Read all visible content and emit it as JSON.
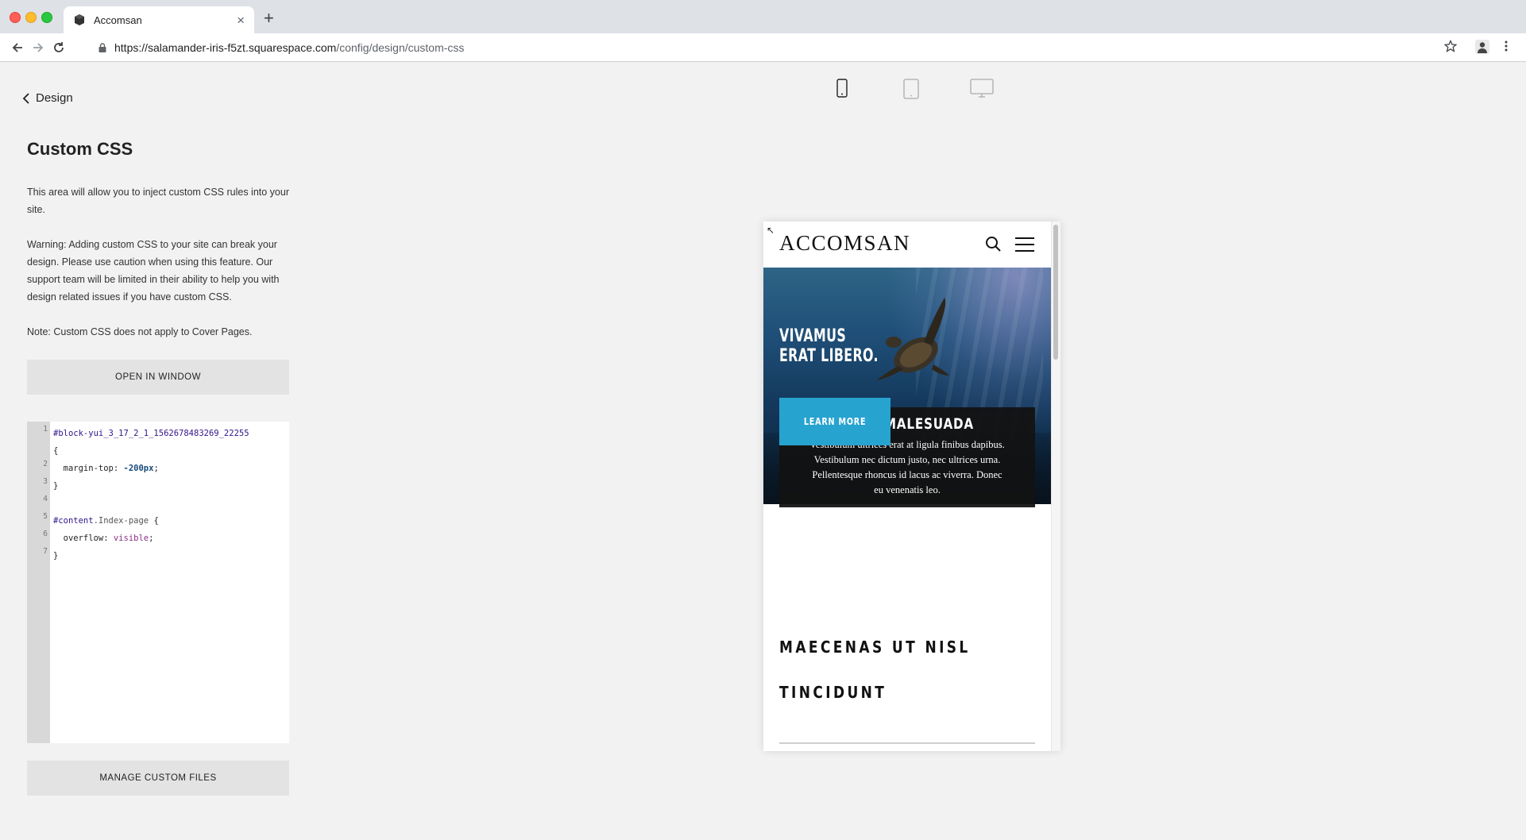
{
  "browser": {
    "tab_title": "Accomsan",
    "new_tab_label": "+",
    "close_label": "×",
    "url_host": "https://salamander-iris-f5zt.squarespace.com",
    "url_path": "/config/design/custom-css"
  },
  "panel": {
    "back_label": "Design",
    "title": "Custom CSS",
    "desc_1": "This area will allow you to inject custom CSS rules into your site.",
    "desc_2": "Warning: Adding custom CSS to your site can break your design. Please use caution when using this feature. Our support team will be limited in their ability to help you with design related issues if you have custom CSS.",
    "desc_3": "Note: Custom CSS does not apply to Cover Pages.",
    "open_window_label": "OPEN IN WINDOW",
    "manage_files_label": "MANAGE CUSTOM FILES"
  },
  "editor": {
    "line_numbers": [
      "1",
      "",
      "2",
      "3",
      "4",
      "5",
      "6",
      "7"
    ],
    "line1_selector": "#block-yui_3_17_2_1_1562678483269_22255",
    "line1b": "{",
    "line2_prop": "  margin-top: ",
    "line2_value": "-200px",
    "line2_end": ";",
    "line3": "}",
    "line4": "",
    "line5_id": "#content",
    "line5_class": ".Index-page",
    "line5_brace": " {",
    "line6_prop": "  overflow: ",
    "line6_value": "visible",
    "line6_end": ";",
    "line7": "}"
  },
  "devices": [
    "phone-icon",
    "tablet-icon",
    "desktop-icon"
  ],
  "preview": {
    "corner_glyph": "↖",
    "logo": "ACCOMSAN",
    "hero_title_1": "VIVAMUS",
    "hero_title_2": "ERAT LIBERO.",
    "learn_more": "LEARN MORE",
    "card_title": "CRAS MALESUADA",
    "card_text": "Vestibulum ultrices erat at ligula finibus dapibus. Vestibulum nec dictum justo, nec ultrices urna. Pellentesque rhoncus id lacus ac viverra. Donec eu venenatis leo.",
    "section_title_1": "MAECENAS UT NISL",
    "section_title_2": "TINCIDUNT"
  },
  "colors": {
    "accent_button": "#27a3d0",
    "panel_bg": "#f2f2f2",
    "button_bg": "#e3e3e3"
  }
}
